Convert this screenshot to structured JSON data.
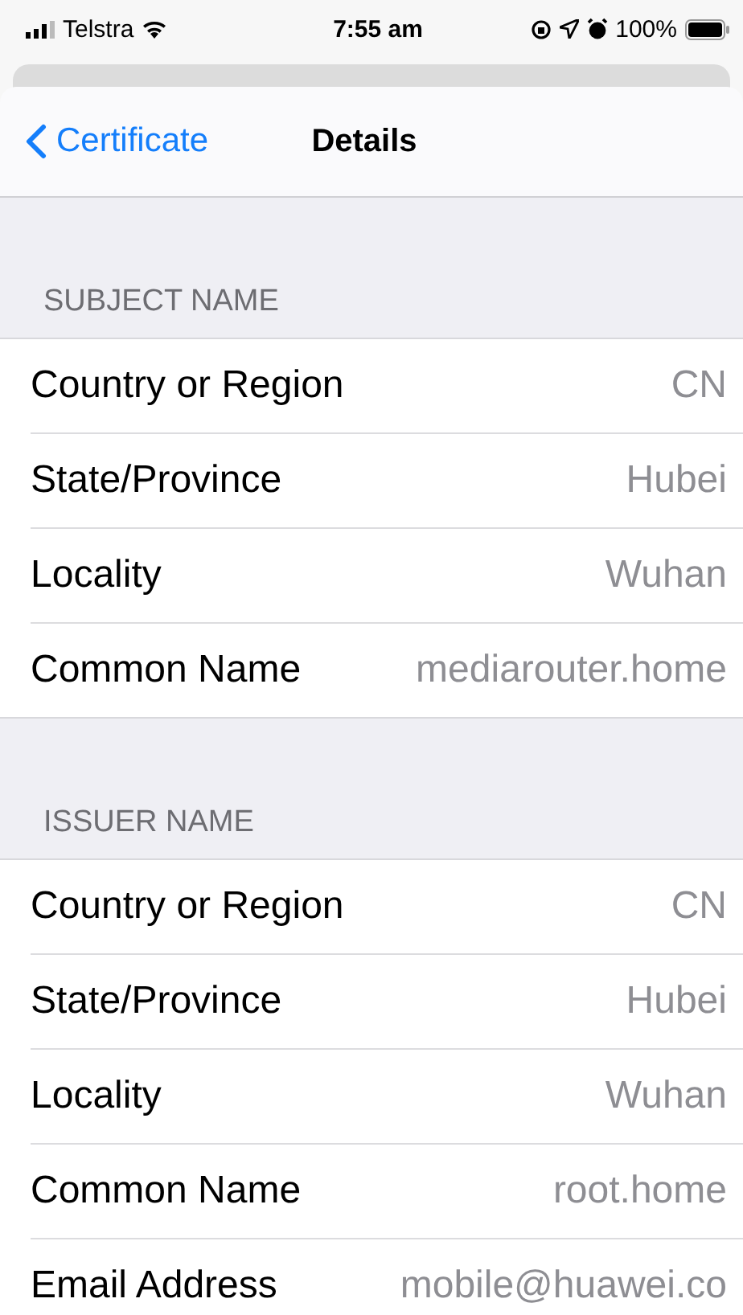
{
  "status_bar": {
    "carrier": "Telstra",
    "time": "7:55 am",
    "battery": "100%"
  },
  "nav_bar": {
    "back": "Certificate",
    "title": "Details"
  },
  "sections": [
    {
      "header": "SUBJECT NAME",
      "rows": [
        {
          "label": "Country or Region",
          "value": "CN"
        },
        {
          "label": "State/Province",
          "value": "Hubei"
        },
        {
          "label": "Locality",
          "value": "Wuhan"
        },
        {
          "label": "Common Name",
          "value": "mediarouter.home"
        }
      ]
    },
    {
      "header": "ISSUER NAME",
      "rows": [
        {
          "label": "Country or Region",
          "value": "CN"
        },
        {
          "label": "State/Province",
          "value": "Hubei"
        },
        {
          "label": "Locality",
          "value": "Wuhan"
        },
        {
          "label": "Common Name",
          "value": "root.home"
        },
        {
          "label": "Email Address",
          "value": "mobile@huawei.co"
        }
      ]
    }
  ]
}
